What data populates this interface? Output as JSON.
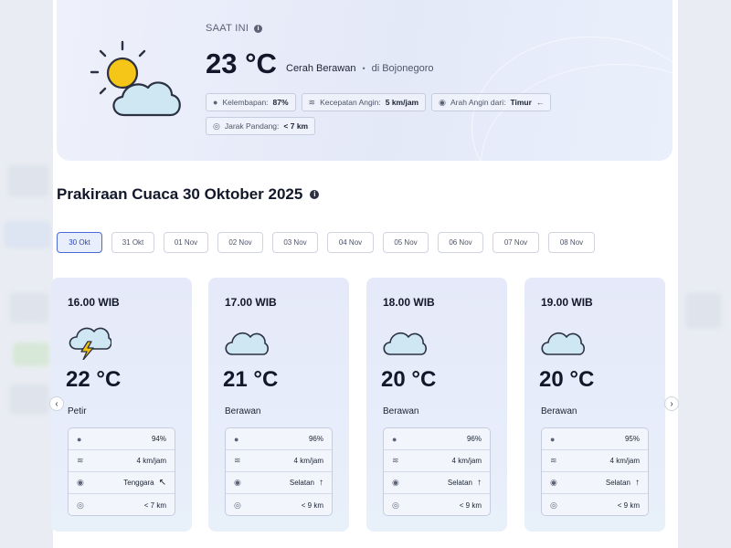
{
  "current": {
    "label": "SAAT INI",
    "temperature": "23 °C",
    "condition": "Cerah Berawan",
    "separator": "•",
    "location": "di Bojonegoro",
    "icon": "sun-cloud-icon",
    "details": [
      {
        "label": "Kelembapan:",
        "value": "87%",
        "icon": "humidity-drop-icon"
      },
      {
        "label": "Kecepatan Angin:",
        "value": "5 km/jam",
        "icon": "wind-icon"
      },
      {
        "label": "Arah Angin dari:",
        "value": "Timur",
        "arrow": "←",
        "icon": "compass-icon"
      },
      {
        "label": "Jarak Pandang:",
        "value": "< 7 km",
        "icon": "eye-icon"
      }
    ]
  },
  "forecast": {
    "title": "Prakiraan Cuaca 30 Oktober 2025",
    "tabs": [
      "30 Okt",
      "31 Okt",
      "01 Nov",
      "02 Nov",
      "03 Nov",
      "04 Nov",
      "05 Nov",
      "06 Nov",
      "07 Nov",
      "08 Nov"
    ],
    "active_tab": "30 Okt",
    "nav_prev": "‹",
    "nav_next": "›",
    "hours": [
      {
        "time": "16.00 WIB",
        "temp": "22 °C",
        "condition": "Petir",
        "icon": "thunderstorm-icon",
        "humidity": "94%",
        "wind_speed": "4 km/jam",
        "wind_dir": "Tenggara",
        "wind_arrow": "↖",
        "visibility": "< 7 km"
      },
      {
        "time": "17.00 WIB",
        "temp": "21 °C",
        "condition": "Berawan",
        "icon": "cloud-icon",
        "humidity": "96%",
        "wind_speed": "4 km/jam",
        "wind_dir": "Selatan",
        "wind_arrow": "↑",
        "visibility": "< 9 km"
      },
      {
        "time": "18.00 WIB",
        "temp": "20 °C",
        "condition": "Berawan",
        "icon": "cloud-icon",
        "humidity": "96%",
        "wind_speed": "4 km/jam",
        "wind_dir": "Selatan",
        "wind_arrow": "↑",
        "visibility": "< 9 km"
      },
      {
        "time": "19.00 WIB",
        "temp": "20 °C",
        "condition": "Berawan",
        "icon": "cloud-icon",
        "humidity": "95%",
        "wind_speed": "4 km/jam",
        "wind_dir": "Selatan",
        "wind_arrow": "↑",
        "visibility": "< 9 km"
      }
    ]
  },
  "colors": {
    "accent": "#4b6ad8",
    "card_bg": "#e5e9f9",
    "cloud": "#cfe6f3",
    "sun": "#f5c518",
    "bolt": "#f4c20d"
  }
}
